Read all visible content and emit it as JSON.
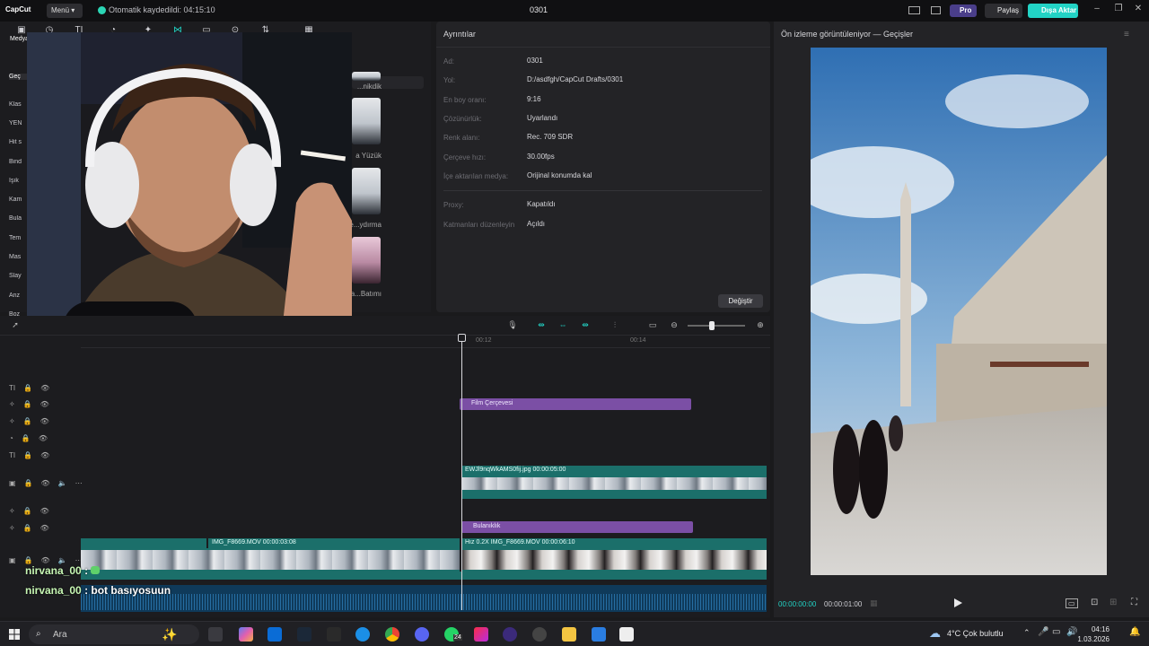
{
  "app": {
    "brand": "CapCut",
    "menu_label": "Menü",
    "autosave_text": "Otomatik kaydedildi: 04:15:10",
    "project_title": "0301",
    "pro_label": "Pro",
    "share_label": "Paylaş",
    "export_label": "Dışa Aktar"
  },
  "left_panel": {
    "top_tab_first": "Medya",
    "categories": [
      "Geç",
      "Klas",
      "YEN",
      "Hit s",
      "Bind",
      "Işık",
      "Kam",
      "Bula",
      "Tem",
      "Mas",
      "Slay",
      "Anz",
      "Boz"
    ],
    "thumb_labels": [
      "...nikdik",
      "a Yüzük",
      "e...ydırma",
      "a...Batımı"
    ]
  },
  "details": {
    "heading": "Ayrıntılar",
    "rows": [
      {
        "label": "Ad:",
        "value": "0301"
      },
      {
        "label": "Yol:",
        "value": "D:/asdfgh/CapCut Drafts/0301"
      },
      {
        "label": "En boy oranı:",
        "value": "9:16"
      },
      {
        "label": "Çözünürlük:",
        "value": "Uyarlandı"
      },
      {
        "label": "Renk alanı:",
        "value": "Rec. 709 SDR"
      },
      {
        "label": "Çerçeve hızı:",
        "value": "30.00fps"
      },
      {
        "label": "İçe aktarılan medya:",
        "value": "Orijinal konumda kal"
      },
      {
        "label": "Proxy:",
        "value": "Kapatıldı"
      },
      {
        "label": "Katmanları düzenleyin",
        "value": "Açıldı"
      }
    ],
    "change_button": "Değiştir"
  },
  "preview": {
    "title": "Ön izleme görüntüleniyor — Geçişler",
    "current_time": "00:00:00:00",
    "total_time": "00:00:01:00"
  },
  "timeline": {
    "ruler_ticks": [
      "00:12",
      "00:14"
    ],
    "clips": {
      "film_frame": "Film Çerçevesi",
      "image_clip": "EWJl9nqWkAMS0fij.jpg   00:00:05:00",
      "blur": "Bulanıklık",
      "main_clip_1": "IMG_F8669.MOV   00:00:03:08",
      "main_clip_2": "Hız 0.2X   IMG_F8669.MOV   00:00:06:10"
    }
  },
  "chat": [
    {
      "nick": "nirvana_00",
      "message": ":"
    },
    {
      "nick": "nirvana_00",
      "message": ": bot basıyosuun"
    }
  ],
  "taskbar": {
    "search_placeholder": "Ara",
    "weather": "4°C  Çok bulutlu",
    "time": "04:16",
    "date": "1.03.2026",
    "whatsapp_badge": "24"
  }
}
